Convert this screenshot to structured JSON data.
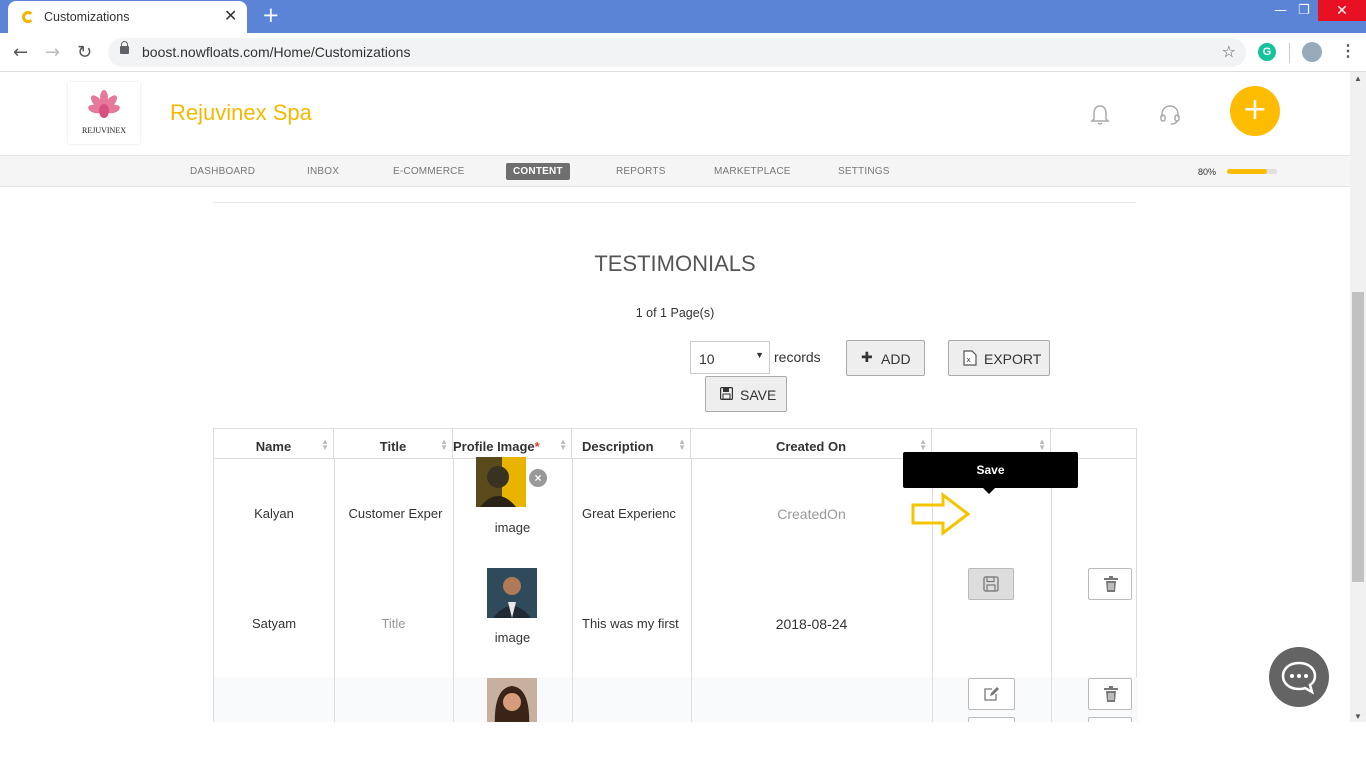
{
  "browser": {
    "tab_title": "Customizations",
    "tab_close": "✕",
    "new_tab": "+",
    "url": "boost.nowfloats.com/Home/Customizations",
    "minimize": "—",
    "restore": "❐",
    "close": "✕"
  },
  "header": {
    "brand_name": "Rejuvinex Spa",
    "logo_text": "REJUVINEX",
    "add_label": "+"
  },
  "nav": {
    "items": [
      "DASHBOARD",
      "INBOX",
      "E-COMMERCE",
      "CONTENT",
      "REPORTS",
      "MARKETPLACE",
      "SETTINGS"
    ],
    "active": "CONTENT",
    "progress_label": "80%",
    "progress_value": 0.8
  },
  "main": {
    "heading": "TESTIMONIALS",
    "pager": "1 of 1 Page(s)",
    "records_value": "10",
    "records_label": "records",
    "add_label": "ADD",
    "export_label": "EXPORT",
    "save_label": "SAVE"
  },
  "table": {
    "columns": [
      "Name",
      "Title",
      "Profile Image",
      "Description",
      "Created On"
    ],
    "required_mark": "*",
    "rows": [
      {
        "name": "Kalyan",
        "title": "Customer Exper",
        "image_label": "image",
        "description": "Great Experienc",
        "created_on": "CreatedOn"
      },
      {
        "name": "Satyam",
        "title": "Title",
        "image_label": "image",
        "description": "This was my first",
        "created_on": "2018-08-24"
      }
    ]
  },
  "tooltip": {
    "text": "Save"
  },
  "colors": {
    "brand": "#f5b800",
    "accent": "#fdbc00",
    "titlebar": "#5c84d6",
    "arrow": "#f5c400"
  }
}
